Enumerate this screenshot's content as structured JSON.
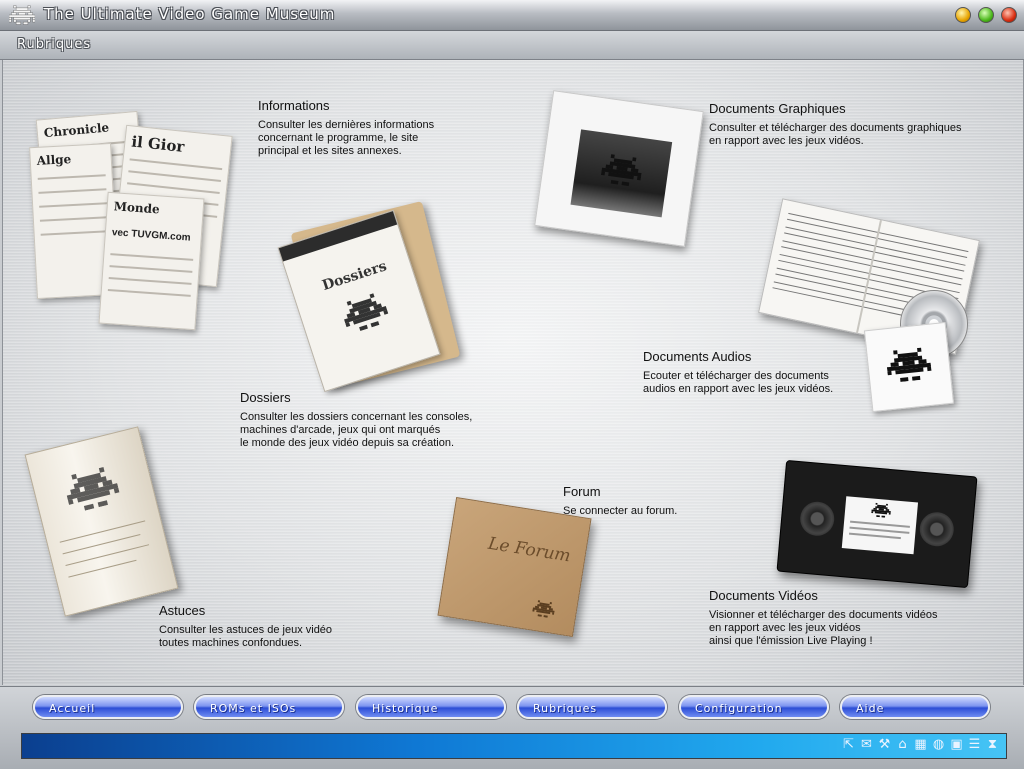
{
  "window": {
    "title": "The Ultimate Video Game Museum"
  },
  "section": {
    "title": "Rubriques"
  },
  "items": {
    "informations": {
      "title": "Informations",
      "desc": "Consulter les dernières informations\nconcernant le programme, le site\nprincipal et les sites annexes.",
      "image_text": [
        "Chronicle",
        "Allge",
        "il Gior",
        "Monde",
        "vec TUVGM.com"
      ]
    },
    "dossiers": {
      "title": "Dossiers",
      "desc": "Consulter les dossiers concernant les consoles,\nmachines d'arcade, jeux qui ont marqués\nle monde des jeux vidéo depuis sa création.",
      "image_text": "Dossiers"
    },
    "docs_graphiques": {
      "title": "Documents Graphiques",
      "desc": "Consulter et télécharger des documents graphiques\nen rapport avec les jeux vidéos."
    },
    "docs_audios": {
      "title": "Documents Audios",
      "desc": "Ecouter et télécharger des documents\naudios en rapport avec les jeux vidéos."
    },
    "astuces": {
      "title": "Astuces",
      "desc": "Consulter les astuces de jeux vidéo\ntoutes machines confondues."
    },
    "forum": {
      "title": "Forum",
      "desc": "Se connecter au forum.",
      "image_text": "Le Forum"
    },
    "docs_videos": {
      "title": "Documents Vidéos",
      "desc": "Visionner et télécharger des documents vidéos\nen rapport avec les jeux vidéos\nainsi que l'émission Live Playing !"
    }
  },
  "nav": {
    "accueil": "Accueil",
    "roms": "ROMs et ISOs",
    "historique": "Historique",
    "rubriques": "Rubriques",
    "configuration": "Configuration",
    "aide": "Aide"
  },
  "tray_icons": [
    "cursor-icon",
    "chat-icon",
    "tools-icon",
    "lock-icon",
    "grid-icon",
    "globe-icon",
    "window-icon",
    "list-icon",
    "hourglass-icon"
  ]
}
